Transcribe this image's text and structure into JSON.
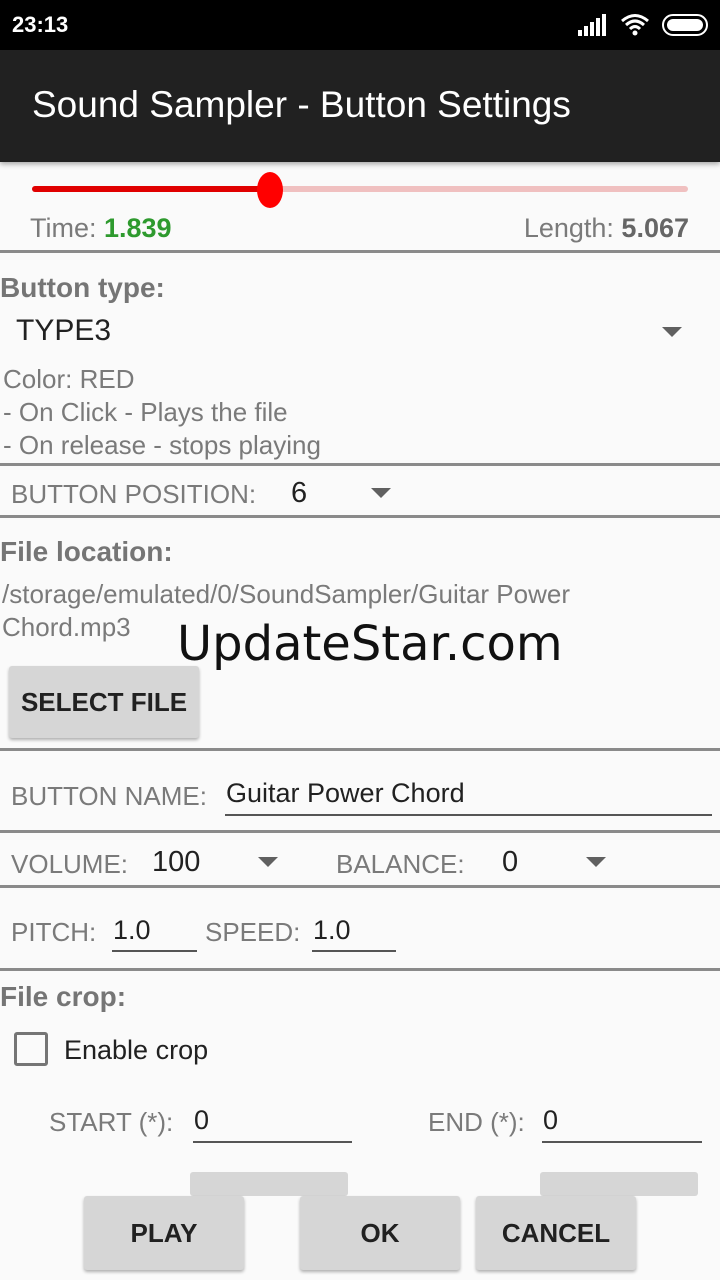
{
  "status_bar": {
    "time": "23:13",
    "icons": [
      "signal-icon",
      "wifi-icon",
      "battery-icon"
    ]
  },
  "app_bar": {
    "title": "Sound Sampler - Button Settings"
  },
  "playback": {
    "time_label": "Time: ",
    "time_value": "1.839",
    "length_label": "Length: ",
    "length_value": "5.067",
    "progress": 0.363
  },
  "button_type": {
    "heading": "Button type:",
    "selected": "TYPE3",
    "description": [
      "Color: RED",
      "- On Click - Plays the file",
      "- On release - stops playing"
    ]
  },
  "button_position": {
    "label": "BUTTON POSITION:",
    "value": "6"
  },
  "file_location": {
    "heading": "File location:",
    "path_line1": "/storage/emulated/0/SoundSampler/Guitar Power",
    "path_line2": "Chord.mp3",
    "select_button": "SELECT FILE"
  },
  "watermark": "UpdateStar.com",
  "button_name": {
    "label": "BUTTON NAME:",
    "value": "Guitar Power Chord"
  },
  "volume": {
    "label": "VOLUME:",
    "value": "100"
  },
  "balance": {
    "label": "BALANCE:",
    "value": "0"
  },
  "pitch": {
    "label": "PITCH:",
    "value": "1.0"
  },
  "speed": {
    "label": "SPEED:",
    "value": "1.0"
  },
  "file_crop": {
    "heading": "File crop:",
    "enable_label": "Enable crop",
    "enabled": false,
    "start_label": "START (*):",
    "start_value": "0",
    "end_label": "END (*):",
    "end_value": "0"
  },
  "actions": {
    "play": "PLAY",
    "ok": "OK",
    "cancel": "CANCEL"
  }
}
